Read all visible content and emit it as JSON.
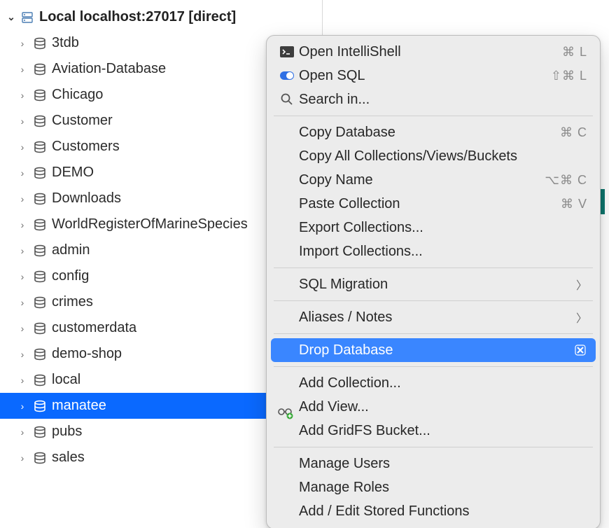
{
  "connection": {
    "label": "Local localhost:27017 [direct]"
  },
  "databases": [
    {
      "name": "3tdb"
    },
    {
      "name": "Aviation-Database"
    },
    {
      "name": "Chicago"
    },
    {
      "name": "Customer"
    },
    {
      "name": "Customers"
    },
    {
      "name": "DEMO"
    },
    {
      "name": "Downloads"
    },
    {
      "name": "WorldRegisterOfMarineSpecies"
    },
    {
      "name": "admin"
    },
    {
      "name": "config"
    },
    {
      "name": "crimes"
    },
    {
      "name": "customerdata"
    },
    {
      "name": "demo-shop"
    },
    {
      "name": "local"
    },
    {
      "name": "manatee",
      "selected": true
    },
    {
      "name": "pubs"
    },
    {
      "name": "sales"
    }
  ],
  "menu": {
    "open_intellishell": {
      "label": "Open IntelliShell",
      "shortcut": "⌘ L"
    },
    "open_sql": {
      "label": "Open SQL",
      "shortcut": "⇧⌘ L"
    },
    "search_in": {
      "label": "Search in..."
    },
    "copy_database": {
      "label": "Copy Database",
      "shortcut": "⌘ C"
    },
    "copy_all": {
      "label": "Copy All Collections/Views/Buckets"
    },
    "copy_name": {
      "label": "Copy Name",
      "shortcut": "⌥⌘ C"
    },
    "paste_collection": {
      "label": "Paste Collection",
      "shortcut": "⌘ V"
    },
    "export_collections": {
      "label": "Export Collections..."
    },
    "import_collections": {
      "label": "Import Collections..."
    },
    "sql_migration": {
      "label": "SQL Migration"
    },
    "aliases_notes": {
      "label": "Aliases / Notes"
    },
    "drop_database": {
      "label": "Drop Database"
    },
    "add_collection": {
      "label": "Add Collection..."
    },
    "add_view": {
      "label": "Add View..."
    },
    "add_gridfs": {
      "label": "Add GridFS Bucket..."
    },
    "manage_users": {
      "label": "Manage Users"
    },
    "manage_roles": {
      "label": "Manage Roles"
    },
    "stored_functions": {
      "label": "Add / Edit Stored Functions"
    }
  }
}
